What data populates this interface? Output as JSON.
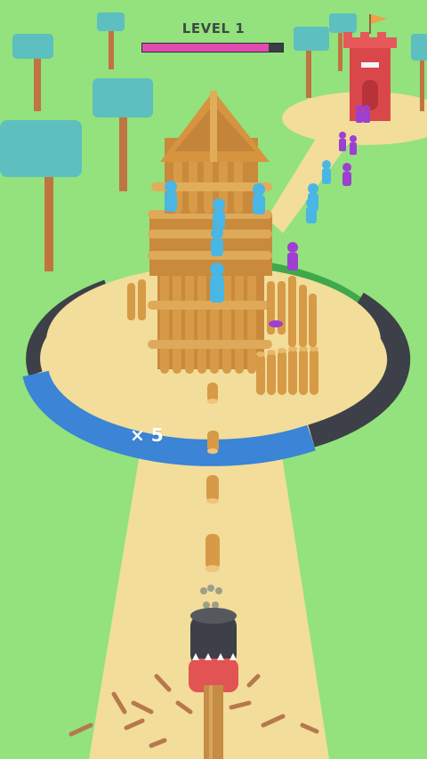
{
  "hud": {
    "level_label": "LEVEL 1",
    "progress": 0.9
  },
  "ring": {
    "multiplier_label": "× 5"
  },
  "colors": {
    "grass": "#93e27d",
    "path": "#f2dd9a",
    "progress_fill": "#e04bb0",
    "ring_blue": "#3b84d6",
    "ring_dark": "#3d4048",
    "ring_green": "#3fa84a",
    "wood": "#d79a47",
    "ally": "#4ab6e4",
    "enemy": "#9d3fd0",
    "enemy_tower": "#d9474a"
  },
  "icons": {
    "log_cannon": "wood-log-launcher",
    "flag": "orange-flag"
  }
}
